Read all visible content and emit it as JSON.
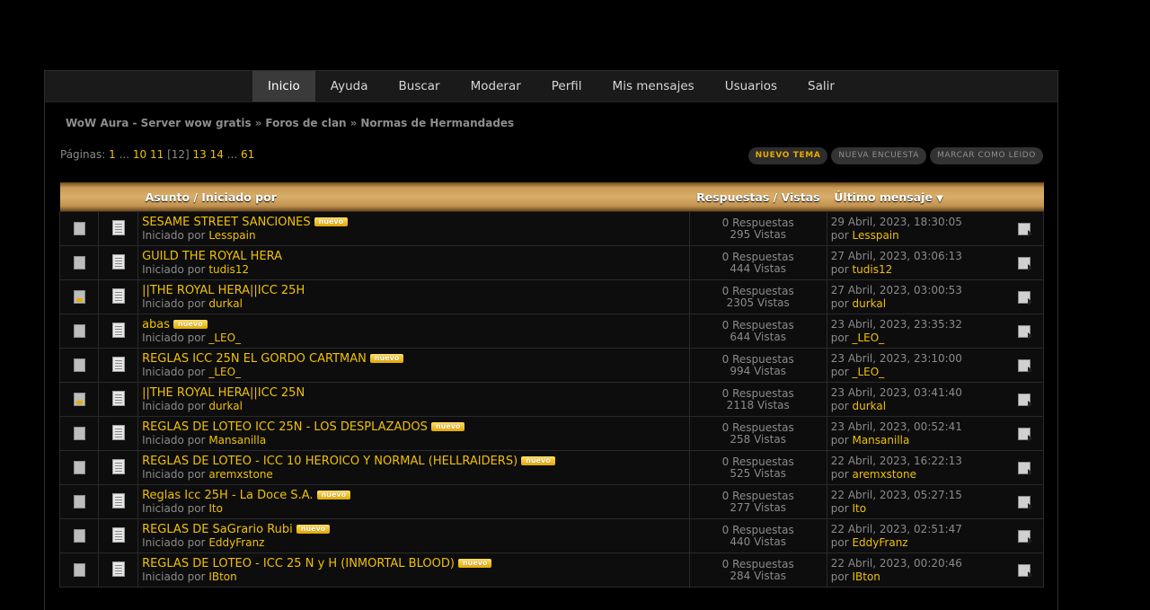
{
  "nav": [
    {
      "label": "Inicio",
      "active": true
    },
    {
      "label": "Ayuda",
      "active": false
    },
    {
      "label": "Buscar",
      "active": false
    },
    {
      "label": "Moderar",
      "active": false
    },
    {
      "label": "Perfil",
      "active": false
    },
    {
      "label": "Mis mensajes",
      "active": false
    },
    {
      "label": "Usuarios",
      "active": false
    },
    {
      "label": "Salir",
      "active": false
    }
  ],
  "breadcrumb": [
    "WoW Aura - Server wow gratis",
    "Foros de clan",
    "Normas de Hermandades"
  ],
  "breadcrumb_sep": "»",
  "pagination": {
    "label": "Páginas:",
    "items": [
      {
        "text": "1",
        "link": true
      },
      {
        "text": "...",
        "link": false
      },
      {
        "text": "10",
        "link": true
      },
      {
        "text": "11",
        "link": true
      },
      {
        "text": "[12]",
        "link": false
      },
      {
        "text": "13",
        "link": true
      },
      {
        "text": "14",
        "link": true
      },
      {
        "text": "...",
        "link": false
      },
      {
        "text": "61",
        "link": true
      }
    ]
  },
  "buttons": {
    "new_topic": "Nuevo tema",
    "new_poll": "Nueva encuesta",
    "mark_read": "Marcar como leido"
  },
  "table": {
    "headers": {
      "subject": "Asunto / Iniciado por",
      "replies": "Respuestas / Vistas",
      "last": "Último mensaje"
    },
    "started_by": "Iniciado por",
    "by": "por",
    "new_badge": "nuevo",
    "rows": [
      {
        "title": "SESAME STREET SANCIONES",
        "new": true,
        "author": "Lesspain",
        "replies": "0 Respuestas",
        "views": "295 Vistas",
        "date": "29 Abril, 2023, 18:30:05",
        "last_by": "Lesspain",
        "hot": false
      },
      {
        "title": "GUILD THE ROYAL HERA",
        "new": false,
        "author": "tudis12",
        "replies": "0 Respuestas",
        "views": "444 Vistas",
        "date": "27 Abril, 2023, 03:06:13",
        "last_by": "tudis12",
        "hot": false
      },
      {
        "title": "||THE ROYAL HERA||ICC 25H",
        "new": false,
        "author": "durkal",
        "replies": "0 Respuestas",
        "views": "2305 Vistas",
        "date": "27 Abril, 2023, 03:00:53",
        "last_by": "durkal",
        "hot": true
      },
      {
        "title": "abas",
        "new": true,
        "author": "_LEO_",
        "replies": "0 Respuestas",
        "views": "644 Vistas",
        "date": "23 Abril, 2023, 23:35:32",
        "last_by": "_LEO_",
        "hot": false
      },
      {
        "title": "REGLAS ICC 25N EL GORDO CARTMAN",
        "new": true,
        "author": "_LEO_",
        "replies": "0 Respuestas",
        "views": "994 Vistas",
        "date": "23 Abril, 2023, 23:10:00",
        "last_by": "_LEO_",
        "hot": false
      },
      {
        "title": "||THE ROYAL HERA||ICC 25N",
        "new": false,
        "author": "durkal",
        "replies": "0 Respuestas",
        "views": "2118 Vistas",
        "date": "23 Abril, 2023, 03:41:40",
        "last_by": "durkal",
        "hot": true
      },
      {
        "title": "REGLAS DE LOTEO ICC 25N - LOS DESPLAZADOS",
        "new": true,
        "author": "Mansanilla",
        "replies": "0 Respuestas",
        "views": "258 Vistas",
        "date": "23 Abril, 2023, 00:52:41",
        "last_by": "Mansanilla",
        "hot": false
      },
      {
        "title": "REGLAS DE LOTEO - ICC 10 HEROICO Y NORMAL (HELLRAIDERS)",
        "new": true,
        "author": "aremxstone",
        "replies": "0 Respuestas",
        "views": "525 Vistas",
        "date": "22 Abril, 2023, 16:22:13",
        "last_by": "aremxstone",
        "hot": false
      },
      {
        "title": "Reglas Icc 25H - La Doce S.A.",
        "new": true,
        "author": "Ito",
        "replies": "0 Respuestas",
        "views": "277 Vistas",
        "date": "22 Abril, 2023, 05:27:15",
        "last_by": "Ito",
        "hot": false
      },
      {
        "title": "REGLAS DE SaGrario Rubi",
        "new": true,
        "author": "EddyFranz",
        "replies": "0 Respuestas",
        "views": "440 Vistas",
        "date": "22 Abril, 2023, 02:51:47",
        "last_by": "EddyFranz",
        "hot": false
      },
      {
        "title": "REGLAS DE LOTEO - ICC 25 N y H (INMORTAL BLOOD)",
        "new": true,
        "author": "IBton",
        "replies": "0 Respuestas",
        "views": "284 Vistas",
        "date": "22 Abril, 2023, 00:20:46",
        "last_by": "IBton",
        "hot": false
      }
    ]
  }
}
